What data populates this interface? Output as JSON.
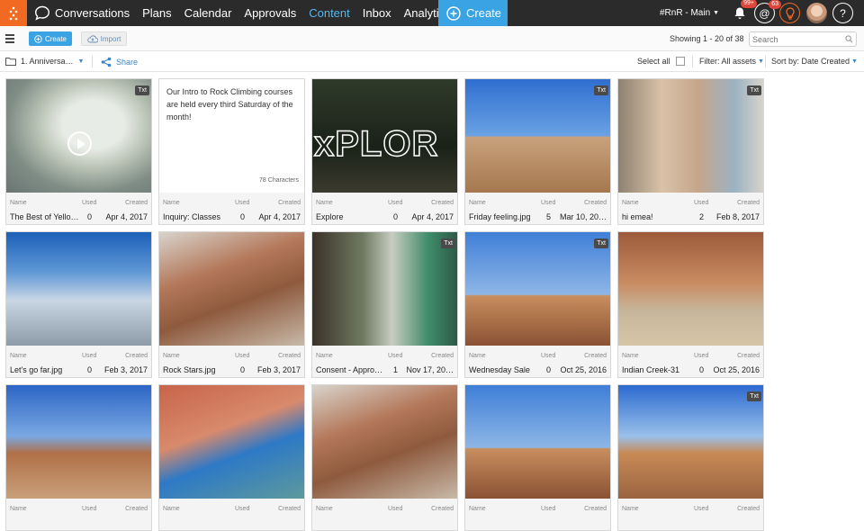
{
  "nav": {
    "items": [
      "Conversations",
      "Plans",
      "Calendar",
      "Approvals",
      "Content",
      "Inbox",
      "Analytics"
    ],
    "active": "Content",
    "create_label": "Create",
    "brand": "#RnR - Main",
    "notif_badge": "99+",
    "mention_badge": "63",
    "help": "?"
  },
  "toolbar": {
    "create_label": "Create",
    "import_label": "Import",
    "showing": "Showing 1 - 20 of 38",
    "search_placeholder": "Search"
  },
  "toolbar2": {
    "folder": "1. Anniversa…",
    "share": "Share",
    "select_all": "Select all",
    "filter": "Filter: All assets",
    "sort": "Sort by: Date Created"
  },
  "meta_labels": {
    "name": "Name",
    "used": "Used",
    "created": "Created"
  },
  "assets": [
    {
      "name": "The Best of Yello…",
      "used": "0",
      "created": "Apr 4, 2017",
      "txt": "Txt",
      "kind": "video"
    },
    {
      "name": "Inquiry: Classes",
      "used": "0",
      "created": "Apr 4, 2017",
      "kind": "text",
      "body": "Our Intro to Rock Climbing courses are held every third Saturday of the month!",
      "chars": "78 Characters"
    },
    {
      "name": "Explore",
      "used": "0",
      "created": "Apr 4, 2017",
      "kind": "explore",
      "overlay": "xPLOR"
    },
    {
      "name": "Friday feeling.jpg",
      "used": "5",
      "created": "Mar 10, 20…",
      "txt": "Txt",
      "kind": "rock-sky"
    },
    {
      "name": "hi emea!",
      "used": "2",
      "created": "Feb 8, 2017",
      "txt": "Txt",
      "kind": "people"
    },
    {
      "name": "Let's go far.jpg",
      "used": "0",
      "created": "Feb 3, 2017",
      "kind": "clouds"
    },
    {
      "name": "Rock Stars.jpg",
      "used": "0",
      "created": "Feb 3, 2017",
      "kind": "boulders"
    },
    {
      "name": "Consent - Appro…",
      "used": "1",
      "created": "Nov 17, 20…",
      "txt": "Txt",
      "kind": "forest"
    },
    {
      "name": "Wednesday Sale",
      "used": "0",
      "created": "Oct 25, 2016",
      "txt": "Txt",
      "kind": "desert-rock"
    },
    {
      "name": "Indian Creek-31",
      "used": "0",
      "created": "Oct 25, 2016",
      "kind": "trucks"
    },
    {
      "name": "",
      "used": "",
      "created": "",
      "kind": "hikers"
    },
    {
      "name": "",
      "used": "",
      "created": "",
      "kind": "climbers"
    },
    {
      "name": "",
      "used": "",
      "created": "",
      "kind": "boulders"
    },
    {
      "name": "",
      "used": "",
      "created": "",
      "kind": "desert-rock"
    },
    {
      "name": "",
      "used": "",
      "created": "",
      "txt": "Txt",
      "kind": "hikers-road"
    }
  ],
  "colors": {
    "nav_bg": "#2b2b2b",
    "brand_orange": "#f26a21",
    "accent_blue": "#3aa3e3",
    "active_nav": "#55b8f0"
  }
}
